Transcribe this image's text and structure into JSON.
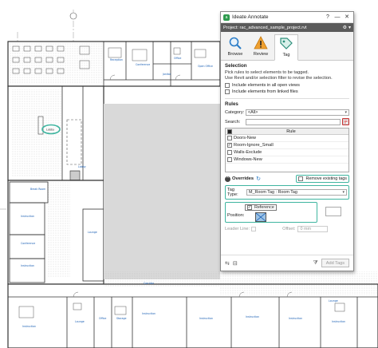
{
  "window": {
    "title": "Ideate Annotate",
    "help_label": "?",
    "minimize_label": "—",
    "close_label": "✕",
    "logo_text": "a"
  },
  "project": {
    "label": "Project: rac_advanced_sample_project.rvt"
  },
  "tabs": [
    {
      "label": "Browse",
      "icon": "magnifier-icon",
      "active": false
    },
    {
      "label": "Review",
      "icon": "warning-icon",
      "active": false
    },
    {
      "label": "Tag",
      "icon": "tag-icon",
      "active": true
    }
  ],
  "selection": {
    "title": "Selection",
    "hint_line1": "Pick rules to select elements to be tagged.",
    "hint_line2": "Use Revit and/or selection filter to revise the selection.",
    "include_open_views": "Include elements in all open views",
    "include_linked": "Include elements from linked files"
  },
  "rules": {
    "title": "Rules",
    "category_label": "Category:",
    "category_value": "<All>",
    "search_label": "Search:",
    "search_value": "",
    "column_rule": "Rule",
    "items": [
      {
        "name": "Doors-New",
        "checked": false
      },
      {
        "name": "Room-Ignore_Small",
        "checked": true
      },
      {
        "name": "Walls-Exclude",
        "checked": false
      },
      {
        "name": "Windows-New",
        "checked": false
      }
    ]
  },
  "overrides": {
    "title": "Overrides",
    "remove_existing": "Remove existing tags",
    "tag_type_label": "Tag Type:",
    "tag_type_value": "M_Room Tag : Room Tag",
    "position_label": "Position:",
    "reference_label": "Reference",
    "leader_label": "Leader Line:",
    "offset_label": "Offset:",
    "offset_value": "0 mm"
  },
  "footer": {
    "add_tags_label": "Add Tags"
  },
  "plan": {
    "room_names": [
      "Reception",
      "Conference",
      "Office",
      "Janitor",
      "Open Office",
      "Lobby",
      "Break Room",
      "Instruction",
      "Conference",
      "Lounge",
      "Corridor",
      "Instruction",
      "Instruction",
      "Lounge",
      "Office",
      "Storage",
      "Instruction",
      "Instruction",
      "Instruction",
      "Instruction",
      "Lounge",
      "Instruction"
    ],
    "tag_text": "Lobby"
  },
  "colors": {
    "highlight": "#3fb5a0",
    "project_bar": "#5b5b5b",
    "room_label": "#1a5fb4",
    "wall": "#3a3a3a"
  }
}
